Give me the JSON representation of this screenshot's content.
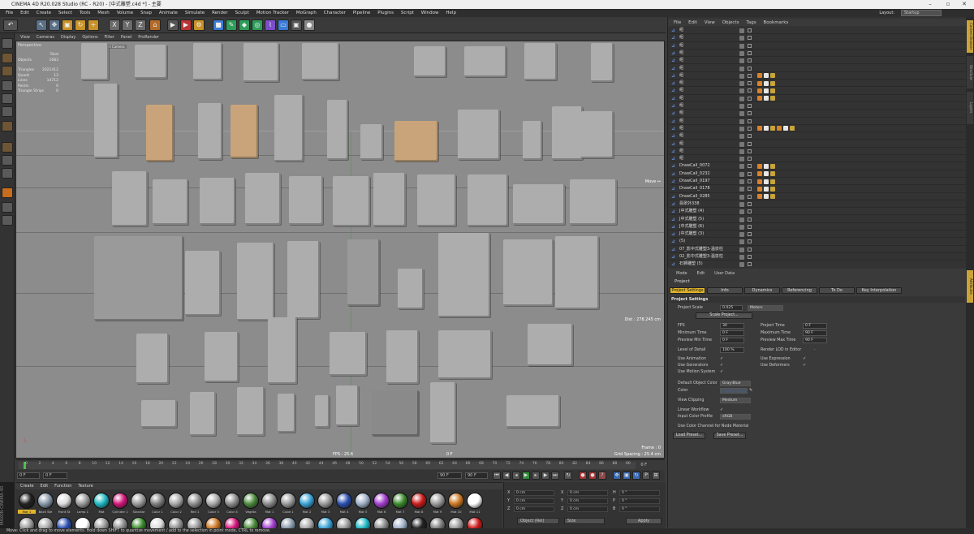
{
  "window": {
    "title": "CINEMA 4D R20.028 Studio (RC - R20) - [中式雕塑.c4d *] - 主要"
  },
  "menubar": {
    "items": [
      "File",
      "Edit",
      "Create",
      "Select",
      "Tools",
      "Mesh",
      "Volume",
      "Snap",
      "Animate",
      "Simulate",
      "Render",
      "Sculpt",
      "Motion Tracker",
      "MoGraph",
      "Character",
      "Pipeline",
      "Plugins",
      "Script",
      "Window",
      "Help"
    ],
    "layout_label": "Layout:",
    "layout_value": "Startup"
  },
  "viewport": {
    "menu": [
      "View",
      "Cameras",
      "Display",
      "Options",
      "Filter",
      "Panel",
      "ProRender"
    ],
    "projection": "Perspective",
    "center_label": "Default Camera",
    "stats_header": "Total",
    "stats": [
      {
        "label": "Objects",
        "value": "1683"
      },
      {
        "label": "Triangles",
        "value": "2021412"
      },
      {
        "label": "Quads",
        "value": "13"
      },
      {
        "label": "Lines",
        "value": "14712"
      },
      {
        "label": "Points",
        "value": "0"
      },
      {
        "label": "Triangle Strips",
        "value": "0"
      }
    ],
    "move_label": "Move ↔",
    "distance": "Dist : 278.245 cm",
    "fps": "FPS : 25.6",
    "frame": "Frame : 0",
    "grid_spacing": "Grid Spacing : 25.4 cm",
    "time": "0 F"
  },
  "timeline": {
    "ticks": [
      "0",
      "2",
      "4",
      "6",
      "8",
      "10",
      "12",
      "14",
      "16",
      "18",
      "20",
      "22",
      "24",
      "26",
      "28",
      "30",
      "32",
      "34",
      "36",
      "38",
      "40",
      "42",
      "44",
      "46",
      "48",
      "50",
      "52",
      "54",
      "56",
      "58",
      "60",
      "62",
      "64",
      "66",
      "68",
      "70",
      "72",
      "74",
      "76",
      "78",
      "80",
      "82",
      "84",
      "86",
      "88",
      "90"
    ],
    "end_marker": "0 F"
  },
  "transport": {
    "current": "0 F",
    "min": "0 F",
    "end": "90 F",
    "max": "90 F"
  },
  "material_panel": {
    "menu": [
      "Create",
      "Edit",
      "Function",
      "Texture"
    ],
    "materials_row1": [
      {
        "name": "Mat 1",
        "color": "#222222"
      },
      {
        "name": "Back Ste",
        "color": "#8899aa"
      },
      {
        "name": "Front St",
        "color": "#dcdcdc"
      },
      {
        "name": "Lamp 1",
        "color": "#9a9a9a"
      },
      {
        "name": "Mat",
        "color": "#1fb7c4"
      },
      {
        "name": "Cylinder 1",
        "color": "#d4157a"
      },
      {
        "name": "Standar",
        "color": "#9a9a9a"
      },
      {
        "name": "Color 1",
        "color": "#7e7e7e"
      },
      {
        "name": "Color 2",
        "color": "#a8a8a8"
      },
      {
        "name": "Red 1",
        "color": "#8e8e8e"
      },
      {
        "name": "Color 3",
        "color": "#aaaaaa"
      },
      {
        "name": "Color 4",
        "color": "#8c8c8c"
      },
      {
        "name": "Vegeta",
        "color": "#4c8a3c"
      },
      {
        "name": "Mat 1",
        "color": "#8c8c8c"
      },
      {
        "name": "Cube 1",
        "color": "#9a9a9a"
      },
      {
        "name": "Mat 2",
        "color": "#3aa3d6"
      },
      {
        "name": "Mat 3",
        "color": "#9a9a9a"
      },
      {
        "name": "Mat 4",
        "color": "#2a4fb0"
      },
      {
        "name": "Mat 5",
        "color": "#a0b0c8"
      },
      {
        "name": "Mat 6",
        "color": "#a33fcf"
      },
      {
        "name": "Mat 7",
        "color": "#3a8a2c"
      },
      {
        "name": "Mat 8",
        "color": "#cc1a1a"
      },
      {
        "name": "Mat 9",
        "color": "#9a9a9a"
      },
      {
        "name": "Mat 10",
        "color": "#cc7722"
      },
      {
        "name": "Mat 11",
        "color": "#ffffff"
      }
    ]
  },
  "coords": {
    "rows": [
      {
        "a": "X",
        "av": "0 cm",
        "b": "X",
        "bv": "0 cm",
        "c": "H",
        "cv": "0 °"
      },
      {
        "a": "Y",
        "av": "0 cm",
        "b": "Y",
        "bv": "0 cm",
        "c": "P",
        "cv": "0 °"
      },
      {
        "a": "Z",
        "av": "0 cm",
        "b": "Z",
        "bv": "0 cm",
        "c": "B",
        "cv": "0 °"
      }
    ],
    "mode": "Object (Rel)",
    "size_mode": "Size",
    "apply": "Apply"
  },
  "status": "Move: Click and drag to move elements. Hold down SHIFT to quantize movement / add to the selection in point mode, CTRL to remove.",
  "object_manager": {
    "menu": [
      "File",
      "Edit",
      "View",
      "Objects",
      "Tags",
      "Bookmarks"
    ],
    "rows": [
      "组",
      "组",
      "组",
      "组",
      "组",
      "组",
      "组",
      "组",
      "组",
      "组",
      "组",
      "组",
      "组",
      "组",
      "组",
      "组",
      "组",
      "组",
      "DrawCall_0072",
      "DrawCall_0232",
      "DrawCall_0197",
      "DrawCall_0178",
      "DrawCall_0285",
      "翡翠外338",
      "J中式雕塑 (4)",
      "J中式雕塑 (5)",
      "J中式雕塑 (6)",
      "J中式雕塑 (3)",
      "(5)",
      "07_影中式雕塑3-温泉柱",
      "02_影中式雕塑3-温泉柱",
      "石狮雕塑 (5)",
      "石狮雕塑 (4)",
      "石狮雕塑"
    ]
  },
  "attributes": {
    "menu": [
      "Mode",
      "Edit",
      "User Data"
    ],
    "title": "Project",
    "tabs": [
      "Project Settings",
      "Info",
      "Dynamics",
      "Referencing",
      "To Do",
      "Key Interpolation"
    ],
    "section": "Project Settings",
    "project_scale_label": "Project Scale",
    "project_scale_value": "0.025",
    "project_scale_unit": "Meters",
    "scale_project_btn": "Scale Project...",
    "left_fields": [
      {
        "label": "FPS",
        "value": "30"
      },
      {
        "label": "Minimum Time",
        "value": "0 F"
      },
      {
        "label": "Preview Min Time",
        "value": "0 F"
      },
      {
        "label": "Level of Detail",
        "value": "100 %"
      }
    ],
    "right_fields": [
      {
        "label": "Project Time",
        "value": "0 F"
      },
      {
        "label": "Maximum Time",
        "value": "90 F"
      },
      {
        "label": "Preview Max Time",
        "value": "90 F"
      },
      {
        "label": "Render LOD in Editor",
        "value": ""
      }
    ],
    "left_checks": [
      "Use Animation",
      "Use Generators",
      "Use Motion System"
    ],
    "right_checks": [
      "Use Expression",
      "Use Deformers"
    ],
    "default_color_label": "Default Object Color",
    "default_color_value": "Gray-Blue",
    "color_label": "Color",
    "view_clipping_label": "View Clipping",
    "view_clipping_value": "Medium",
    "linear_workflow_label": "Linear Workflow",
    "input_color_label": "Input Color Profile",
    "input_color_value": "sRGB",
    "node_material_label": "Use Color Channel for Node Material",
    "load_preset": "Load Preset...",
    "save_preset": "Save Preset..."
  },
  "right_strip": [
    "Content Browser",
    "Structure",
    "Layers",
    "Attributes"
  ]
}
